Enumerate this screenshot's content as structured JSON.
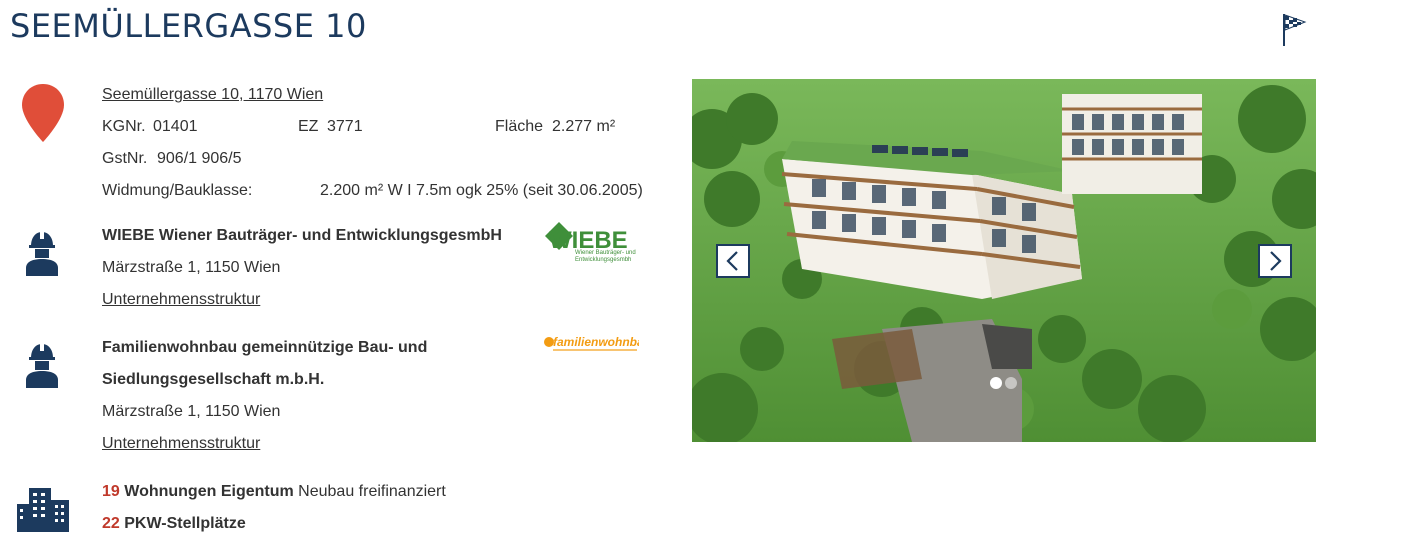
{
  "header": {
    "title": "SEEMÜLLERGASSE 10",
    "flag_icon": "checkered-flag-icon"
  },
  "location": {
    "address": "Seemüllergasse 10, 1170 Wien",
    "kgnr_label": "KGNr.",
    "kgnr_value": "01401",
    "ez_label": "EZ",
    "ez_value": "3771",
    "flaeche_label": "Fläche",
    "flaeche_value": "2.277 m²",
    "gstnr_label": "GstNr.",
    "gstnr_value": "906/1 906/5",
    "widmung_label": "Widmung/Bauklasse:",
    "widmung_value": "2.200 m² W I 7.5m ogk 25% (seit 30.06.2005)",
    "pin_color": "#e04e39"
  },
  "developers": [
    {
      "name": "WIEBE Wiener Bauträger- und EntwicklungsgesmbH",
      "address": "Märzstraße 1, 1150 Wien",
      "link": "Unternehmensstruktur",
      "logo_text": "WIEBE",
      "logo_subtext_1": "Wiener Bauträger- und",
      "logo_subtext_2": "Entwicklungsgesmbh"
    },
    {
      "name_line1": "Familienwohnbau gemeinnützige Bau- und",
      "name_line2": "Siedlungsgesellschaft m.b.H.",
      "address": "Märzstraße 1, 1150 Wien",
      "link": "Unternehmensstruktur",
      "logo_text": "familienwohnbau"
    }
  ],
  "summary": {
    "units_count": "19",
    "units_label": "Wohnungen Eigentum",
    "units_type": "Neubau freifinanziert",
    "parking_count": "22",
    "parking_label": "PKW-Stellplätze"
  },
  "gallery": {
    "prev_icon": "chevron-left-icon",
    "next_icon": "chevron-right-icon",
    "slide_count": 2,
    "active_slide": 1
  },
  "colors": {
    "brand_navy": "#1c3a5e",
    "accent_red": "#c0392b",
    "wiebe_green": "#3f8f3a",
    "fwb_orange": "#f39c12"
  }
}
